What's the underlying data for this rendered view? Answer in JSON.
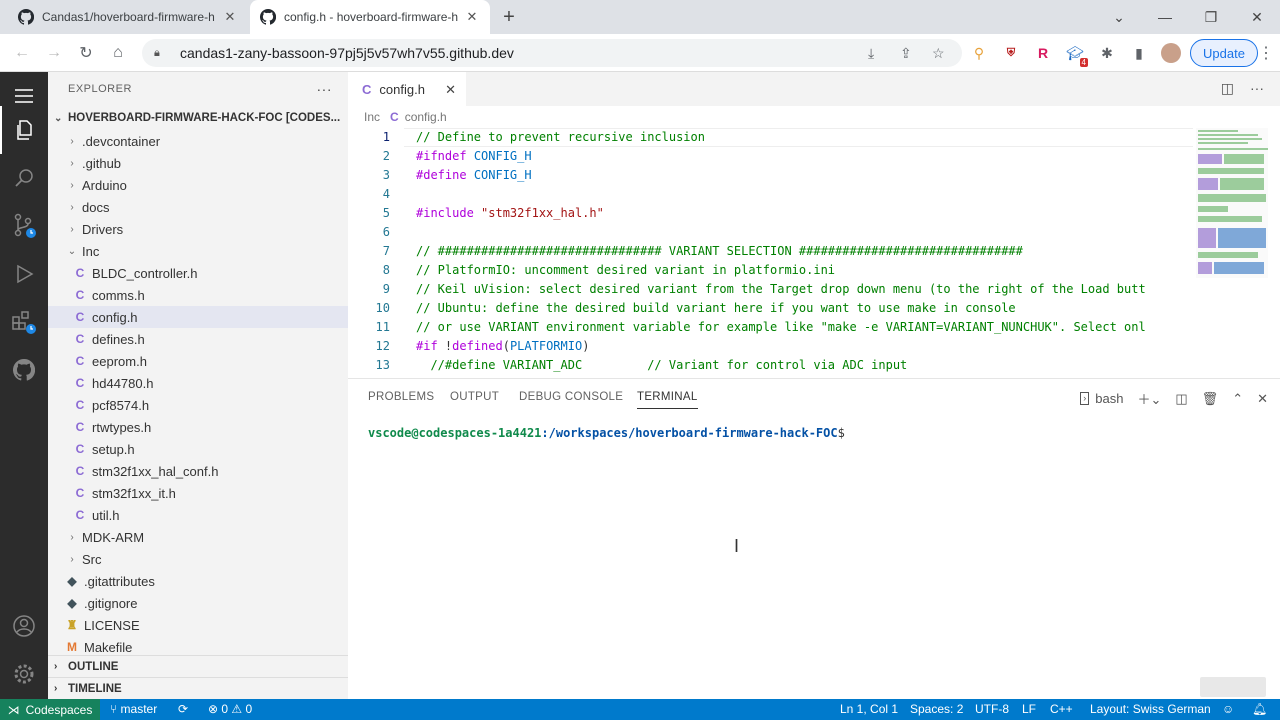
{
  "browser": {
    "tabs": [
      {
        "title": "Candas1/hoverboard-firmware-h",
        "icon": "github-icon"
      },
      {
        "title": "config.h - hoverboard-firmware-h",
        "icon": "github-icon"
      }
    ],
    "url": "candas1-zany-bassoon-97pj5j5v57wh7v55.github.dev",
    "update_label": "Update",
    "ext_badge": "4"
  },
  "sidebar": {
    "title": "EXPLORER",
    "project": "HOVERBOARD-FIRMWARE-HACK-FOC [CODES...",
    "items": [
      {
        "label": ".devcontainer",
        "type": "folder",
        "depth": 1
      },
      {
        "label": ".github",
        "type": "folder",
        "depth": 1
      },
      {
        "label": "Arduino",
        "type": "folder",
        "depth": 1
      },
      {
        "label": "docs",
        "type": "folder",
        "depth": 1
      },
      {
        "label": "Drivers",
        "type": "folder",
        "depth": 1
      },
      {
        "label": "Inc",
        "type": "folder-open",
        "depth": 1
      },
      {
        "label": "BLDC_controller.h",
        "type": "c",
        "depth": 2
      },
      {
        "label": "comms.h",
        "type": "c",
        "depth": 2
      },
      {
        "label": "config.h",
        "type": "c",
        "depth": 2,
        "selected": true
      },
      {
        "label": "defines.h",
        "type": "c",
        "depth": 2
      },
      {
        "label": "eeprom.h",
        "type": "c",
        "depth": 2
      },
      {
        "label": "hd44780.h",
        "type": "c",
        "depth": 2
      },
      {
        "label": "pcf8574.h",
        "type": "c",
        "depth": 2
      },
      {
        "label": "rtwtypes.h",
        "type": "c",
        "depth": 2
      },
      {
        "label": "setup.h",
        "type": "c",
        "depth": 2
      },
      {
        "label": "stm32f1xx_hal_conf.h",
        "type": "c",
        "depth": 2
      },
      {
        "label": "stm32f1xx_it.h",
        "type": "c",
        "depth": 2
      },
      {
        "label": "util.h",
        "type": "c",
        "depth": 2
      },
      {
        "label": "MDK-ARM",
        "type": "folder",
        "depth": 1
      },
      {
        "label": "Src",
        "type": "folder",
        "depth": 1
      },
      {
        "label": ".gitattributes",
        "type": "git",
        "depth": 1
      },
      {
        "label": ".gitignore",
        "type": "git",
        "depth": 1
      },
      {
        "label": "LICENSE",
        "type": "license",
        "depth": 1
      },
      {
        "label": "Makefile",
        "type": "make",
        "depth": 1
      }
    ],
    "outline": "OUTLINE",
    "timeline": "TIMELINE"
  },
  "editor": {
    "tab": "config.h",
    "breadcrumb": [
      "Inc",
      "config.h"
    ],
    "lines": [
      {
        "n": "1",
        "html": "<span class='c-com'>// Define to prevent recursive inclusion</span>"
      },
      {
        "n": "2",
        "html": "<span class='c-kw'>#ifndef</span> <span class='c-mac'>CONFIG_H</span>"
      },
      {
        "n": "3",
        "html": "<span class='c-kw'>#define</span> <span class='c-mac'>CONFIG_H</span>"
      },
      {
        "n": "4",
        "html": ""
      },
      {
        "n": "5",
        "html": "<span class='c-kw'>#include</span> <span class='c-str'>\"stm32f1xx_hal.h\"</span>"
      },
      {
        "n": "6",
        "html": ""
      },
      {
        "n": "7",
        "html": "<span class='c-com'>// ############################### VARIANT SELECTION ###############################</span>"
      },
      {
        "n": "8",
        "html": "<span class='c-com'>// PlatformIO: uncomment desired variant in platformio.ini</span>"
      },
      {
        "n": "9",
        "html": "<span class='c-com'>// Keil uVision: select desired variant from the Target drop down menu (to the right of the Load butt</span>"
      },
      {
        "n": "10",
        "html": "<span class='c-com'>// Ubuntu: define the desired build variant here if you want to use make in console</span>"
      },
      {
        "n": "11",
        "html": "<span class='c-com'>// or use VARIANT environment variable for example like \"make -e VARIANT=VARIANT_NUNCHUK\". Select onl</span>"
      },
      {
        "n": "12",
        "html": "<span class='c-kw'>#if</span> !<span class='c-kw'>defined</span>(<span class='c-mac'>PLATFORMIO</span>)"
      },
      {
        "n": "13",
        "html": "  <span class='c-com'>//#define VARIANT_ADC         // Variant for control via ADC input</span>"
      }
    ]
  },
  "panel": {
    "tabs": [
      "PROBLEMS",
      "OUTPUT",
      "DEBUG CONSOLE",
      "TERMINAL"
    ],
    "active_tab": "TERMINAL",
    "shell": "bash",
    "prompt_user": "vscode@codespaces-1a4421",
    "prompt_path": ":/workspaces/hoverboard-firmware-hack-FOC",
    "prompt_end": "$"
  },
  "statusbar": {
    "remote": "Codespaces",
    "branch": "master",
    "errors": "0",
    "warnings": "0",
    "position": "Ln 1, Col 1",
    "spaces": "Spaces: 2",
    "encoding": "UTF-8",
    "eol": "LF",
    "language": "C++",
    "layout": "Layout: Swiss German"
  }
}
